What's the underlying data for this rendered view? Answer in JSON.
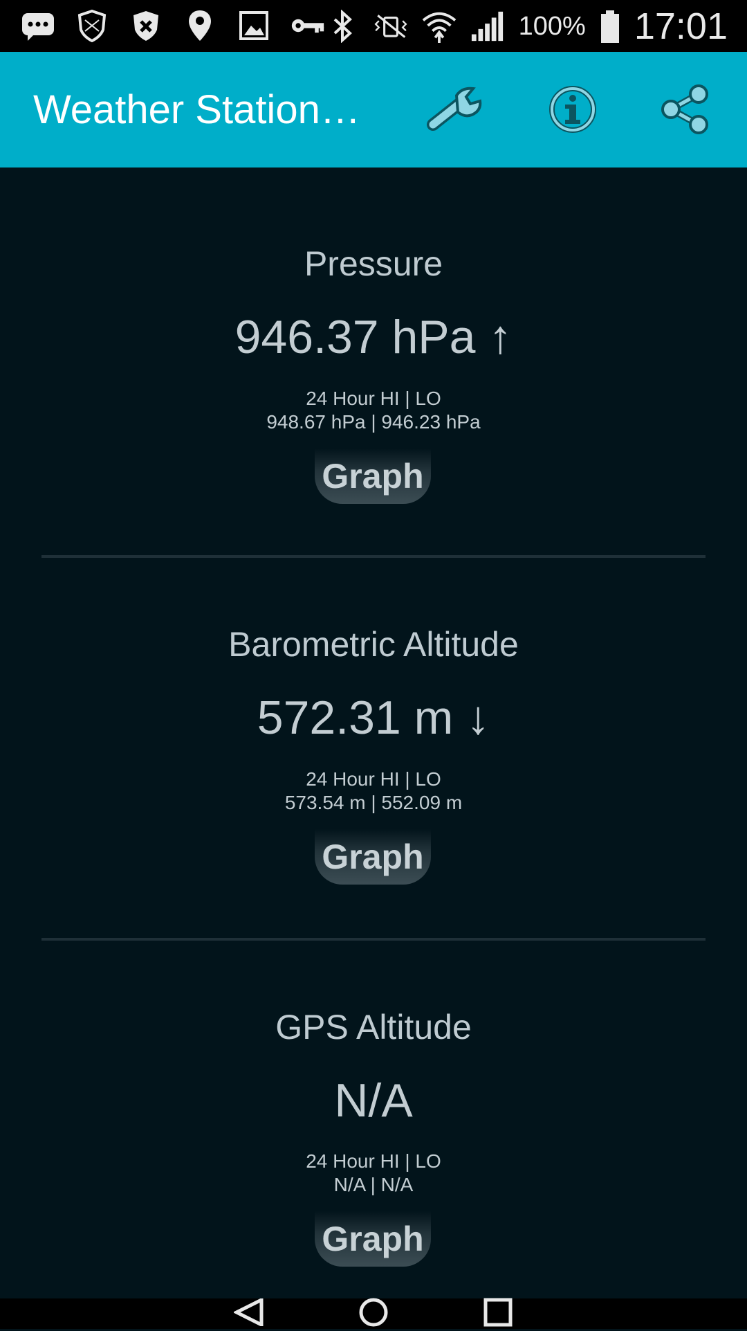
{
  "status_bar": {
    "left_icons": [
      "chat-bubble-icon",
      "shield-outline-icon",
      "shield-x-icon",
      "location-pin-icon",
      "image-icon",
      "key-icon"
    ],
    "right_icons": [
      "bluetooth-icon",
      "vibrate-off-icon",
      "wifi-icon",
      "signal-icon",
      "battery-icon"
    ],
    "battery": "100%",
    "time": "17:01"
  },
  "app_bar": {
    "title": "Weather Station…",
    "actions": [
      "wrench-icon",
      "info-icon",
      "share-icon"
    ],
    "color": "#00aec9"
  },
  "cards": [
    {
      "title": "Pressure",
      "value": "946.37 hPa ↑",
      "hilo_label": "24 Hour HI | LO",
      "hilo_values": "948.67 hPa | 946.23 hPa",
      "button": "Graph"
    },
    {
      "title": "Barometric Altitude",
      "value": "572.31 m ↓",
      "hilo_label": "24 Hour HI | LO",
      "hilo_values": "573.54 m | 552.09 m",
      "button": "Graph"
    },
    {
      "title": "GPS Altitude",
      "value": "N/A",
      "hilo_label": "24 Hour HI | LO",
      "hilo_values": "N/A | N/A",
      "button": "Graph"
    }
  ],
  "nav_bar": {
    "buttons": [
      "back-icon",
      "home-icon",
      "recents-icon"
    ]
  }
}
